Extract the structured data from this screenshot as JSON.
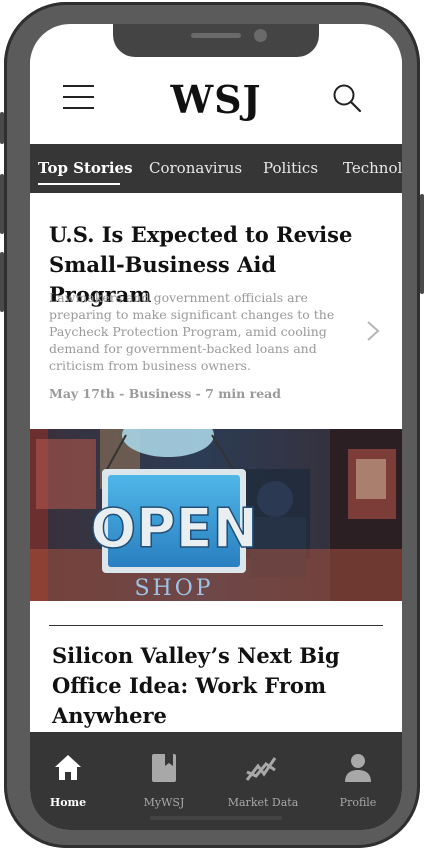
{
  "app": {
    "logo": "WSJ"
  },
  "header": {
    "menu_icon": "hamburger-menu-icon",
    "search_icon": "search-icon"
  },
  "tabs": [
    {
      "label": "Top Stories",
      "active": true
    },
    {
      "label": "Coronavirus",
      "active": false
    },
    {
      "label": "Politics",
      "active": false
    },
    {
      "label": "Technology",
      "active": false
    }
  ],
  "articles": [
    {
      "title": "U.S. Is Expected to Revise Small-Business Aid Program",
      "summary": "Lawmakers and government officials are preparing to make significant changes to the Paycheck Protection Program, amid cooling demand for government-backed loans and criticism from business owners.",
      "meta": "May 17th - Business - 7 min read"
    },
    {
      "title": "Silicon Valley’s Next Big Office Idea: Work From Anywhere"
    }
  ],
  "hero_image": {
    "sign_text": "OPEN",
    "subtext": "SHOP"
  },
  "bottom_nav": [
    {
      "label": "Home",
      "icon": "home-icon",
      "active": true
    },
    {
      "label": "MyWSJ",
      "icon": "bookmark-book-icon",
      "active": false
    },
    {
      "label": "Market Data",
      "icon": "chart-line-icon",
      "active": false
    },
    {
      "label": "Profile",
      "icon": "profile-icon",
      "active": false
    }
  ],
  "colors": {
    "bar_bg": "#363636",
    "text_dark": "#111111",
    "summary_gray": "#9a9a9a",
    "active_white": "#ffffff"
  }
}
